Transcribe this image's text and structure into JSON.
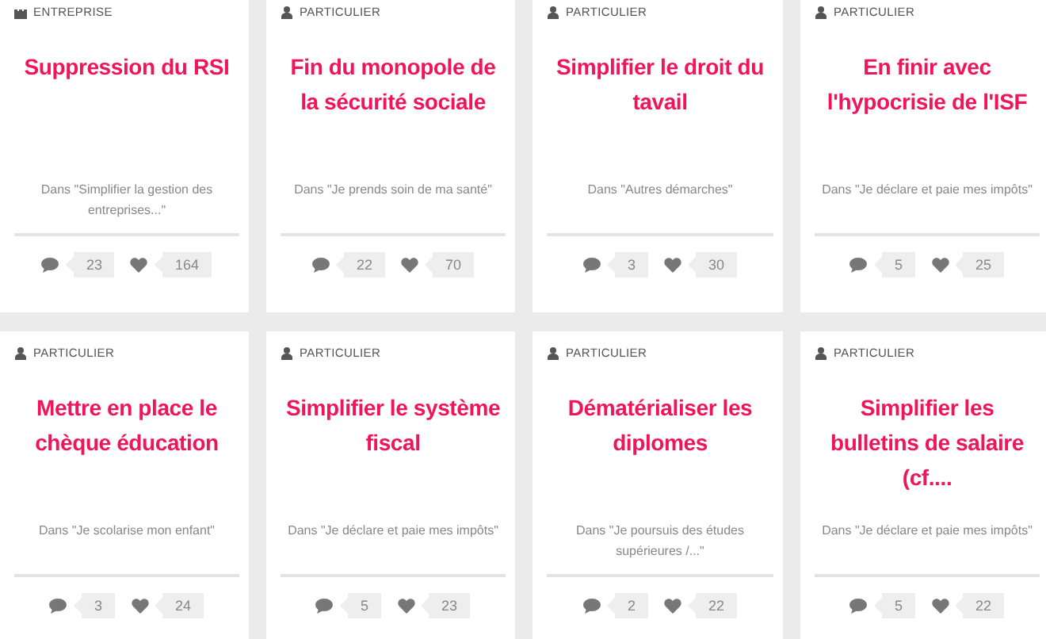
{
  "rows": [
    [
      {
        "category": "ENTREPRISE",
        "kind": "entreprise",
        "title": "Suppression du RSI",
        "context": "Dans \"Simplifier la gestion des entreprises...\"",
        "comments": "23",
        "likes": "164"
      },
      {
        "category": "PARTICULIER",
        "kind": "particulier",
        "title": "Fin du monopole de la sécurité sociale",
        "context": "Dans \"Je prends soin de ma santé\"",
        "comments": "22",
        "likes": "70"
      },
      {
        "category": "PARTICULIER",
        "kind": "particulier",
        "title": "Simplifier le droit du tavail",
        "context": "Dans \"Autres démarches\"",
        "comments": "3",
        "likes": "30"
      },
      {
        "category": "PARTICULIER",
        "kind": "particulier",
        "title": "En finir avec l'hypocrisie de l'ISF",
        "context": "Dans \"Je déclare et paie mes impôts\"",
        "comments": "5",
        "likes": "25"
      }
    ],
    [
      {
        "category": "PARTICULIER",
        "kind": "particulier",
        "title": "Mettre en place le chèque éducation",
        "context": "Dans \"Je scolarise mon enfant\"",
        "comments": "3",
        "likes": "24"
      },
      {
        "category": "PARTICULIER",
        "kind": "particulier",
        "title": "Simplifier le système fiscal",
        "context": "Dans \"Je déclare et paie mes impôts\"",
        "comments": "5",
        "likes": "23"
      },
      {
        "category": "PARTICULIER",
        "kind": "particulier",
        "title": "Dématérialiser les diplomes",
        "context": "Dans \"Je poursuis des études supérieures /...\"",
        "comments": "2",
        "likes": "22"
      },
      {
        "category": "PARTICULIER",
        "kind": "particulier",
        "title": "Simplifier les bulletins de salaire (cf....",
        "context": "Dans \"Je déclare et paie mes impôts\"",
        "comments": "5",
        "likes": "22"
      }
    ]
  ]
}
